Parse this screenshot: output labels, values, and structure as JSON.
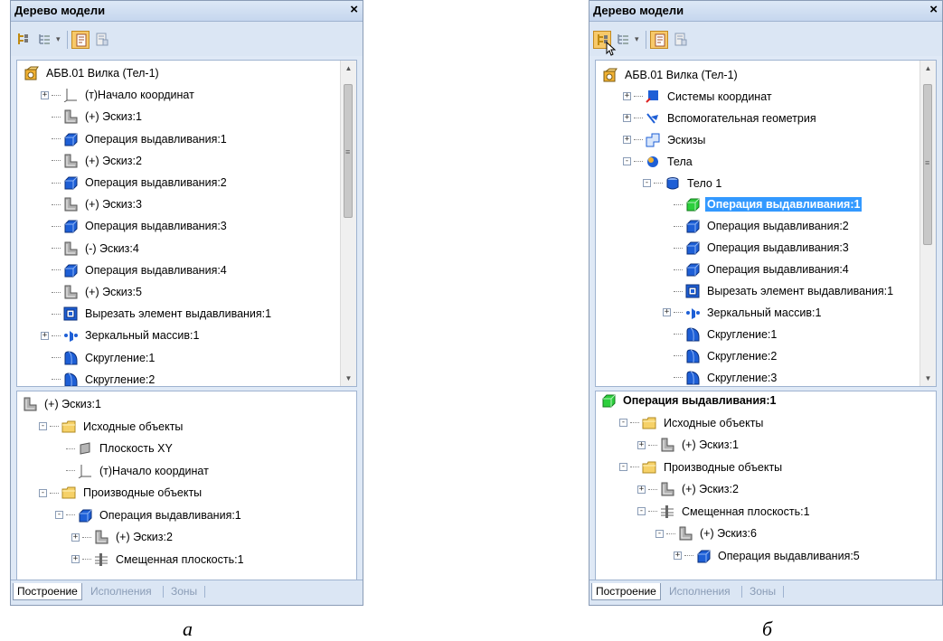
{
  "panel_a": {
    "title": "Дерево модели",
    "close": "×",
    "tree": [
      {
        "label": "АБВ.01 Вилка (Тел-1)",
        "icon": "part-icon",
        "level": 0,
        "exp": ""
      },
      {
        "label": "(т)Начало координат",
        "icon": "origin-icon",
        "level": 1,
        "exp": "+"
      },
      {
        "label": "(+) Эскиз:1",
        "icon": "sketch-icon",
        "level": 1,
        "exp": ""
      },
      {
        "label": "Операция выдавливания:1",
        "icon": "extrude-icon",
        "level": 1,
        "exp": ""
      },
      {
        "label": "(+) Эскиз:2",
        "icon": "sketch-icon",
        "level": 1,
        "exp": ""
      },
      {
        "label": "Операция выдавливания:2",
        "icon": "extrude-icon",
        "level": 1,
        "exp": ""
      },
      {
        "label": "(+) Эскиз:3",
        "icon": "sketch-icon",
        "level": 1,
        "exp": ""
      },
      {
        "label": "Операция выдавливания:3",
        "icon": "extrude-icon",
        "level": 1,
        "exp": ""
      },
      {
        "label": "(-) Эскиз:4",
        "icon": "sketch-icon",
        "level": 1,
        "exp": ""
      },
      {
        "label": "Операция выдавливания:4",
        "icon": "extrude-icon",
        "level": 1,
        "exp": ""
      },
      {
        "label": "(+) Эскиз:5",
        "icon": "sketch-icon",
        "level": 1,
        "exp": ""
      },
      {
        "label": "Вырезать элемент выдавливания:1",
        "icon": "cut-icon",
        "level": 1,
        "exp": ""
      },
      {
        "label": "Зеркальный массив:1",
        "icon": "mirror-icon",
        "level": 1,
        "exp": "+"
      },
      {
        "label": "Скругление:1",
        "icon": "fillet-icon",
        "level": 1,
        "exp": ""
      },
      {
        "label": "Скругление:2",
        "icon": "fillet-icon",
        "level": 1,
        "exp": ""
      }
    ],
    "detail": [
      {
        "label": "(+) Эскиз:1",
        "icon": "sketch-icon",
        "level": 0,
        "exp": "",
        "bold": false
      },
      {
        "label": "Исходные объекты",
        "icon": "folder-icon",
        "level": 1,
        "exp": "-"
      },
      {
        "label": "Плоскость XY",
        "icon": "plane-icon",
        "level": 2,
        "exp": ""
      },
      {
        "label": "(т)Начало координат",
        "icon": "origin-icon",
        "level": 2,
        "exp": ""
      },
      {
        "label": "Производные объекты",
        "icon": "folder-icon",
        "level": 1,
        "exp": "-"
      },
      {
        "label": "Операция выдавливания:1",
        "icon": "extrude-icon",
        "level": 2,
        "exp": "-"
      },
      {
        "label": "(+) Эскиз:2",
        "icon": "sketch-icon",
        "level": 3,
        "exp": "+"
      },
      {
        "label": "Смещенная плоскость:1",
        "icon": "offset-plane-icon",
        "level": 3,
        "exp": "+"
      }
    ],
    "tabs": [
      "Построение",
      "Исполнения",
      "Зоны"
    ]
  },
  "panel_b": {
    "title": "Дерево модели",
    "close": "×",
    "tree": [
      {
        "label": "АБВ.01 Вилка (Тел-1)",
        "icon": "part-icon",
        "level": 0,
        "exp": ""
      },
      {
        "label": "Системы координат",
        "icon": "coord-systems-icon",
        "level": 1,
        "exp": "+"
      },
      {
        "label": "Вспомогательная геометрия",
        "icon": "aux-geometry-icon",
        "level": 1,
        "exp": "+"
      },
      {
        "label": "Эскизы",
        "icon": "sketches-icon",
        "level": 1,
        "exp": "+"
      },
      {
        "label": "Тела",
        "icon": "bodies-icon",
        "level": 1,
        "exp": "-"
      },
      {
        "label": "Тело 1",
        "icon": "body-icon",
        "level": 2,
        "exp": "-"
      },
      {
        "label": "Операция выдавливания:1",
        "icon": "extrude-green-icon",
        "level": 3,
        "exp": "",
        "sel": true
      },
      {
        "label": "Операция выдавливания:2",
        "icon": "extrude-icon",
        "level": 3,
        "exp": ""
      },
      {
        "label": "Операция выдавливания:3",
        "icon": "extrude-icon",
        "level": 3,
        "exp": ""
      },
      {
        "label": "Операция выдавливания:4",
        "icon": "extrude-icon",
        "level": 3,
        "exp": ""
      },
      {
        "label": "Вырезать элемент выдавливания:1",
        "icon": "cut-icon",
        "level": 3,
        "exp": ""
      },
      {
        "label": "Зеркальный массив:1",
        "icon": "mirror-icon",
        "level": 3,
        "exp": "+"
      },
      {
        "label": "Скругление:1",
        "icon": "fillet-icon",
        "level": 3,
        "exp": ""
      },
      {
        "label": "Скругление:2",
        "icon": "fillet-icon",
        "level": 3,
        "exp": ""
      },
      {
        "label": "Скругление:3",
        "icon": "fillet-icon",
        "level": 3,
        "exp": ""
      }
    ],
    "detail": [
      {
        "label": "Операция выдавливания:1",
        "icon": "extrude-green-icon",
        "level": 0,
        "exp": "",
        "bold": true
      },
      {
        "label": "Исходные объекты",
        "icon": "folder-icon",
        "level": 1,
        "exp": "-"
      },
      {
        "label": "(+) Эскиз:1",
        "icon": "sketch-icon",
        "level": 2,
        "exp": "+"
      },
      {
        "label": "Производные объекты",
        "icon": "folder-icon",
        "level": 1,
        "exp": "-"
      },
      {
        "label": "(+) Эскиз:2",
        "icon": "sketch-icon",
        "level": 2,
        "exp": "+"
      },
      {
        "label": "Смещенная плоскость:1",
        "icon": "offset-plane-icon",
        "level": 2,
        "exp": "-"
      },
      {
        "label": "(+) Эскиз:6",
        "icon": "sketch-icon",
        "level": 3,
        "exp": "-"
      },
      {
        "label": "Операция выдавливания:5",
        "icon": "extrude-icon",
        "level": 4,
        "exp": "+"
      }
    ],
    "tabs": [
      "Построение",
      "Исполнения",
      "Зоны"
    ]
  },
  "captions": {
    "a": "а",
    "b": "б"
  }
}
